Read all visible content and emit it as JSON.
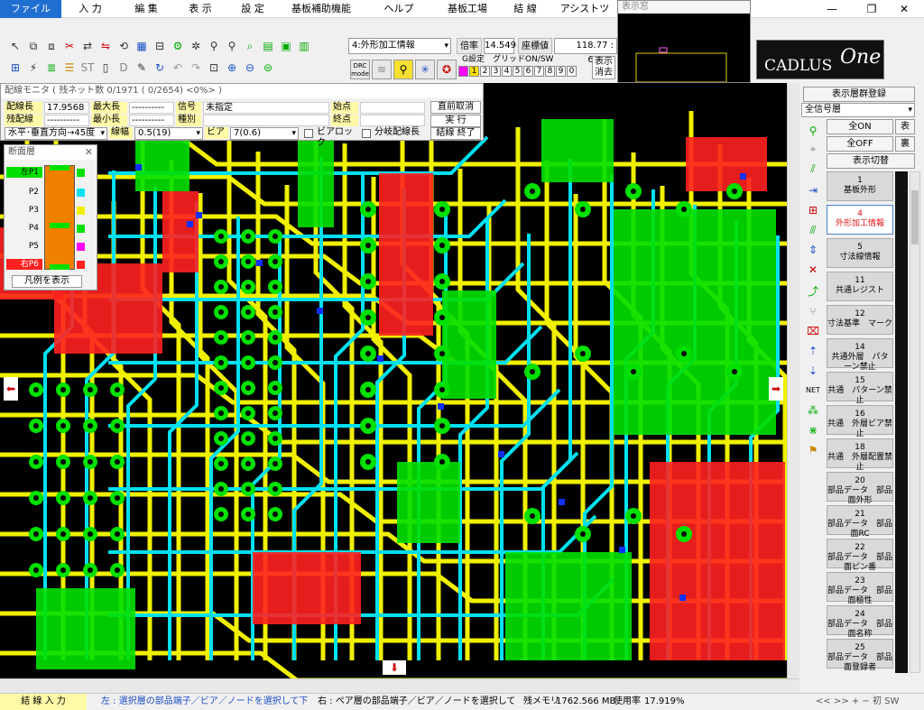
{
  "menu": [
    "ファイル",
    "入 力",
    "編 集",
    "表 示",
    "設 定",
    "基板補助機能",
    "ヘルプ",
    "基板工場",
    "結 線",
    "アシストツール"
  ],
  "preview": {
    "title": "表示窓"
  },
  "window_controls": {
    "minimize": "—",
    "restore": "❐",
    "close": "✕"
  },
  "toolbar": {
    "layer_combo": "4:外形加工情報",
    "ratio_label": "倍率",
    "ratio_value": "14.549",
    "coord_label": "座標値",
    "coord_value": "118.77 : 65.59",
    "drc_label": "DRC\nmode",
    "grid_label": "G設定　グリッドON/SW",
    "grid_values": [
      "1",
      "2",
      "3",
      "4",
      "5",
      "6",
      "7",
      "8",
      "9",
      "0"
    ],
    "display_label": "表示",
    "erase_label": "消去"
  },
  "logo": {
    "text": "CADLUS",
    "suffix": "One"
  },
  "monitor": {
    "title": "配線モニタ  ( 残ネット数 0/1971 ( 0/2654) <0%> )",
    "wire_length_label": "配線長",
    "wire_length_value": "17.9568",
    "max_length_label": "最大長",
    "max_length_value": "----------",
    "signal_label": "信号",
    "signal_value": "未指定",
    "start_label": "始点",
    "remain_label": "残配線",
    "remain_value": "----------",
    "min_length_label": "最小長",
    "min_length_value": "----------",
    "type_label": "種別",
    "end_label": "終点",
    "direction_value": "水平･垂直方向→45度",
    "width_label": "線幅",
    "width_value": "0.5(19)",
    "via_label": "ビア",
    "via_value": "7(0.6)",
    "via_lock_label": "ビアロック",
    "branch_label": "分岐配線長",
    "btn_cancel": "直前取消",
    "btn_exec": "実  行",
    "btn_end": "結線 終了"
  },
  "section": {
    "title": "断面層",
    "layers": [
      "左P1",
      "P2",
      "P3",
      "P4",
      "P5",
      "右P6"
    ],
    "layer_colors": [
      "#00e000",
      "#00e0f0",
      "#f0f000",
      "#00e000",
      "#ff00ff",
      "#ff2020"
    ],
    "legend_button": "凡例を表示"
  },
  "right_panel": {
    "group_button": "表示層群登録",
    "all_layers": "全信号層",
    "all_on": "全ON",
    "all_off": "全OFF",
    "front": "表",
    "back": "裏",
    "toggle": "表示切替",
    "layers": [
      {
        "num": "1",
        "name": "基板外形"
      },
      {
        "num": "4",
        "name": "外形加工情報"
      },
      {
        "num": "5",
        "name": "寸法線情報"
      },
      {
        "num": "11",
        "name": "共通レジスト"
      },
      {
        "num": "12",
        "name": "寸法基準　マーク"
      },
      {
        "num": "14",
        "name": "共通外層　パターン禁止"
      },
      {
        "num": "15",
        "name": "共通　パターン禁止"
      },
      {
        "num": "16",
        "name": "共通　外層ビア禁止"
      },
      {
        "num": "18",
        "name": "共通　外層配置禁止"
      },
      {
        "num": "20",
        "name": "部品データ　部品面外形"
      },
      {
        "num": "21",
        "name": "部品データ　部品面RC"
      },
      {
        "num": "22",
        "name": "部品データ　部品面ピン番"
      },
      {
        "num": "23",
        "name": "部品データ　部品面極性"
      },
      {
        "num": "24",
        "name": "部品データ　部品面名称"
      },
      {
        "num": "25",
        "name": "部品データ　部品面登録者"
      }
    ],
    "selected_index": 1
  },
  "statusbar": {
    "mode": "結 線 入 力",
    "left_hint": "左 : 選択層の部品端子／ビア／ノードを選択して下さい",
    "right_hint": "右 : ペア層の部品端子／ビア／ノードを選択して下さい",
    "memory_label": "残メモリ",
    "memory_value": "1762.566 MB",
    "usage_label": "使用率",
    "usage_value": "17.919%",
    "nav": "<<  >>  +  −  初  SW"
  }
}
